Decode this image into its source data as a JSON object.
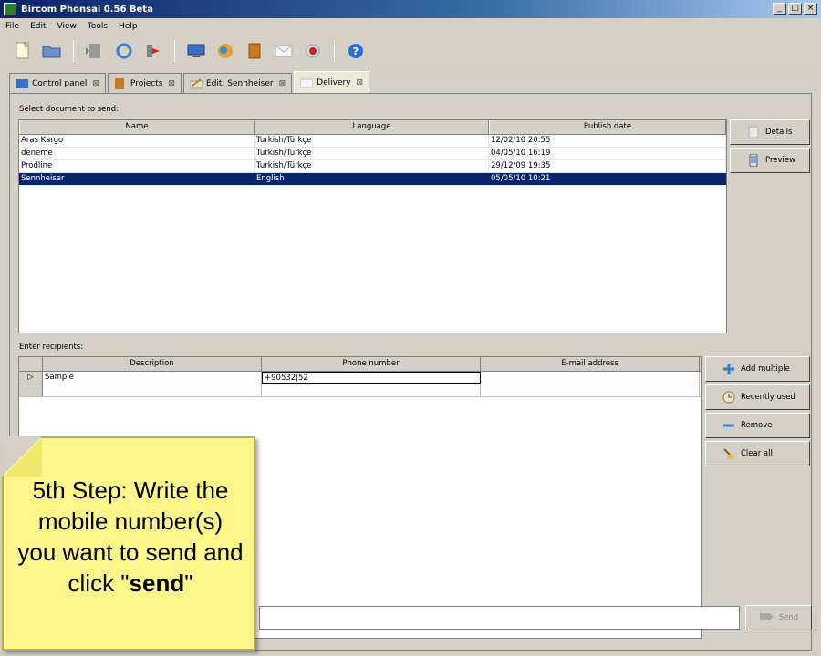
{
  "window": {
    "title": "Bircom Phonsai 0.56 Beta",
    "buttons": [
      "_",
      "□",
      "×"
    ]
  },
  "menu": [
    "File",
    "Edit",
    "View",
    "Tools",
    "Help"
  ],
  "toolbar": {
    "icons": [
      "new-document-icon",
      "open-folder-icon",
      "back-icon",
      "refresh-icon",
      "export-icon",
      "monitor-icon",
      "globe-icon",
      "book-icon",
      "mail-icon",
      "record-icon",
      "help-icon"
    ]
  },
  "tabs": [
    {
      "label": "Control panel",
      "close": "⊠"
    },
    {
      "label": "Projects",
      "close": "⊠"
    },
    {
      "label": "Edit: Sennheiser",
      "close": "⊠"
    },
    {
      "label": "Delivery",
      "close": "⊠"
    }
  ],
  "documents": {
    "label": "Select document to send:",
    "columns": [
      "Name",
      "Language",
      "Publish date"
    ],
    "rows": [
      {
        "name": "Aras Kargo",
        "language": "Turkish/Türkçe",
        "date": "12/02/10 20:55"
      },
      {
        "name": "deneme",
        "language": "Turkish/Türkçe",
        "date": "04/05/10 16:19"
      },
      {
        "name": "Prodline",
        "language": "Turkish/Türkçe",
        "date": "29/12/09 19:35"
      },
      {
        "name": "Sennheiser",
        "language": "English",
        "date": "05/05/10 10:21"
      }
    ],
    "details_label": "Details",
    "preview_label": "Preview"
  },
  "recipients": {
    "label": "Enter recipients:",
    "columns": [
      "Description",
      "Phone number",
      "E-mail address"
    ],
    "rows": [
      {
        "marker": "▷",
        "description": "Sample",
        "phone": "+90532|52",
        "email": ""
      },
      {
        "marker": "",
        "description": "",
        "phone": "",
        "email": ""
      }
    ],
    "add_multiple_label": "Add multiple",
    "recently_used_label": "Recently used",
    "remove_label": "Remove",
    "clear_all_label": "Clear all"
  },
  "note": {
    "line_before": "5th Step: Write the mobile number(s) you want to send and click \"",
    "bold": "send",
    "line_after": "\""
  },
  "send": {
    "input_value": "",
    "button_label": "Send"
  }
}
